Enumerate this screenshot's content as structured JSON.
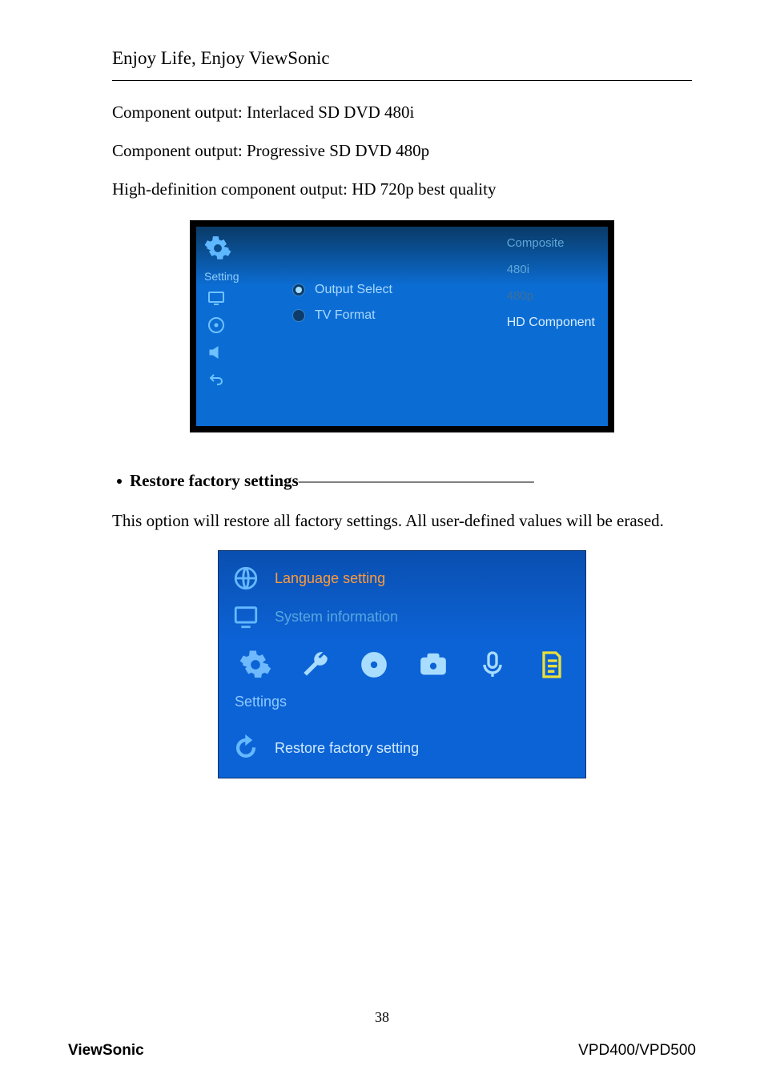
{
  "header": {
    "tagline": "Enjoy Life, Enjoy ViewSonic"
  },
  "body": {
    "line1": "Component output: Interlaced SD DVD 480i",
    "line2": "Component output: Progressive SD DVD 480p",
    "line3": "High-definition component output: HD 720p best quality"
  },
  "screenshot1": {
    "setting_label": "Setting",
    "menu_output_select": "Output Select",
    "menu_tv_format": "TV Format",
    "options": {
      "composite": "Composite",
      "r480i": "480i",
      "r480p": "480p",
      "hd": "HD Component"
    }
  },
  "bullet_heading": {
    "title": "Restore factory settings",
    "dashes": " ——————————————"
  },
  "restore_text": "This option will restore all factory settings.    All user-defined values will be erased.",
  "screenshot2": {
    "language_setting": "Language setting",
    "system_information": "System information",
    "settings": "Settings",
    "restore_factory": "Restore factory setting"
  },
  "footer": {
    "page": "38",
    "brand": "ViewSonic",
    "model": "VPD400/VPD500"
  }
}
